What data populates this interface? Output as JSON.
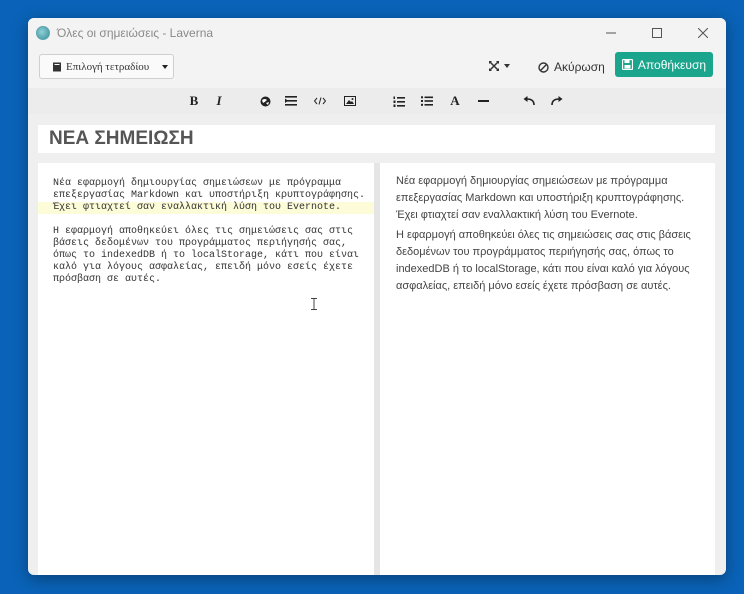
{
  "window": {
    "title": "Όλες οι σημειώσεις - Laverna"
  },
  "toolbar": {
    "notebook_select_label": "Επιλογή τετραδίου",
    "cancel_label": "Ακύρωση",
    "save_label": "Αποθήκευση",
    "save_color": "#1aa58c"
  },
  "format_buttons": {
    "bold": "B",
    "italic": "I",
    "font": "A"
  },
  "note": {
    "title": "ΝΕΑ ΣΗΜΕΙΩΣΗ",
    "editor_lines": [
      "Νέα εφαρμογή δημιουργίας σημειώσεων με πρόγραμμα",
      "επεξεργασίας Markdown και υποστήριξη κρυπτογράφησης.",
      "Έχει φτιαχτεί σαν εναλλακτική λύση του Evernote.",
      "",
      "Η εφαρμογή αποθηκεύει όλες τις σημειώσεις σας στις",
      "βάσεις δεδομένων του προγράμματος περιήγησής σας,",
      "όπως το indexedDB ή το localStorage, κάτι που είναι",
      "καλό για λόγους ασφαλείας, επειδή μόνο εσείς έχετε",
      "πρόσβαση σε αυτές."
    ],
    "preview_paragraphs": [
      "Νέα εφαρμογή δημιουργίας σημειώσεων με πρόγραμμα επεξεργασίας Markdown και υποστήριξη κρυπτογράφησης. Έχει φτιαχτεί σαν εναλλακτική λύση του Evernote.",
      "Η εφαρμογή αποθηκεύει όλες τις σημειώσεις σας στις βάσεις δεδομένων του προγράμματος περιήγησής σας, όπως το indexedDB ή το localStorage, κάτι που είναι καλό για λόγους ασφαλείας, επειδή μόνο εσείς έχετε πρόσβαση σε αυτές."
    ]
  },
  "icons": [
    "app-icon",
    "minimize-icon",
    "maximize-icon",
    "close-icon",
    "book-icon",
    "fullscreen-icon",
    "cancel-icon",
    "save-icon",
    "link-icon",
    "quote-icon",
    "code-icon",
    "image-icon",
    "ordered-list-icon",
    "unordered-list-icon",
    "horizontal-rule-icon",
    "undo-icon",
    "redo-icon",
    "text-cursor-icon"
  ]
}
